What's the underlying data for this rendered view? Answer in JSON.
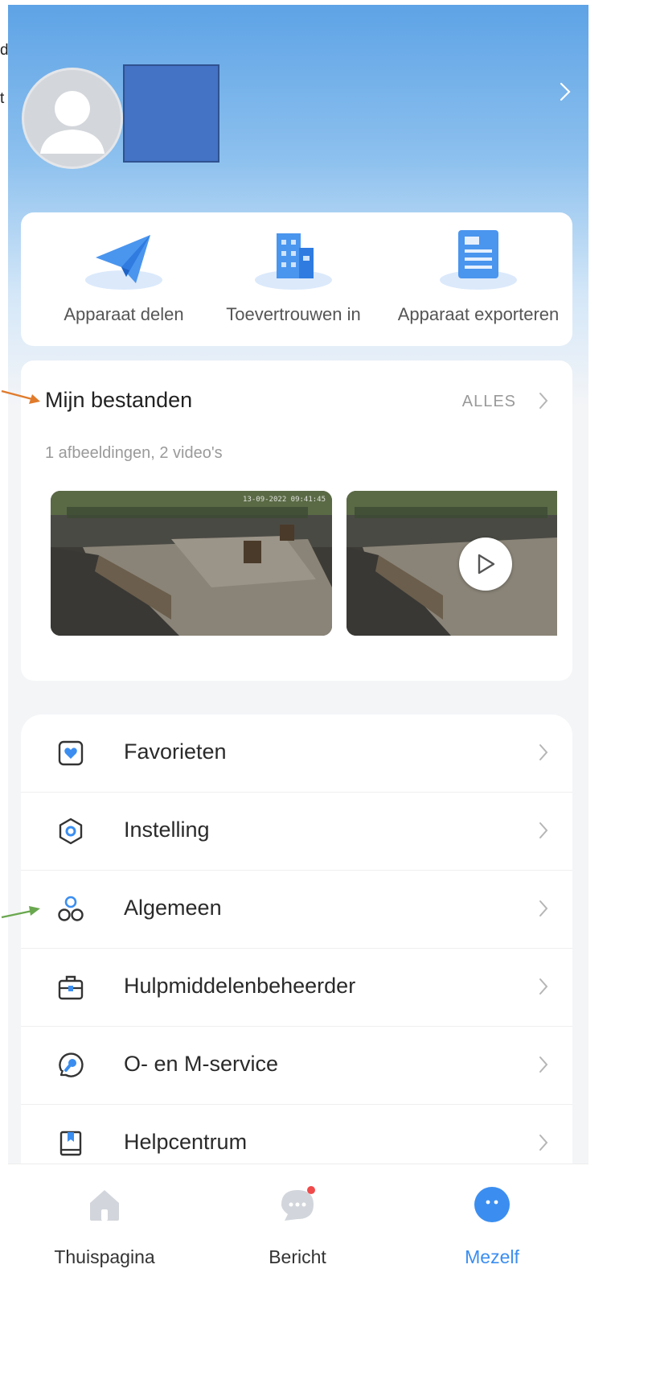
{
  "margin_notes": {
    "line1": "d",
    "line2": "t"
  },
  "header": {
    "username": ""
  },
  "quick_actions": [
    {
      "label": "Apparaat delen",
      "icon": "paper-plane-icon"
    },
    {
      "label": "Toevertrouwen in",
      "icon": "building-icon"
    },
    {
      "label": "Apparaat exporteren",
      "icon": "document-list-icon"
    }
  ],
  "files": {
    "title": "Mijn bestanden",
    "all_label": "ALLES",
    "summary": "1 afbeeldingen, 2 video's",
    "thumbnails": [
      {
        "type": "image",
        "timestamp": "13-09-2022 09:41:45"
      },
      {
        "type": "video"
      }
    ]
  },
  "menu": [
    {
      "label": "Favorieten",
      "icon": "heart-frame-icon"
    },
    {
      "label": "Instelling",
      "icon": "settings-hexagon-icon"
    },
    {
      "label": "Algemeen",
      "icon": "group-circles-icon"
    },
    {
      "label": "Hulpmiddelenbeheerder",
      "icon": "toolbox-icon"
    },
    {
      "label": "O- en M-service",
      "icon": "wrench-circle-icon"
    },
    {
      "label": "Helpcentrum",
      "icon": "book-icon"
    }
  ],
  "bottom_nav": [
    {
      "label": "Thuispagina",
      "icon": "home-icon",
      "active": false
    },
    {
      "label": "Bericht",
      "icon": "chat-bubble-icon",
      "active": false,
      "badge": true
    },
    {
      "label": "Mezelf",
      "icon": "face-icon",
      "active": true
    }
  ],
  "colors": {
    "accent": "#3b8ef0",
    "icon_blue": "#2f7be0",
    "arrow_orange": "#e07b2c",
    "arrow_green": "#6aa84f",
    "redaction": "#4472c4"
  }
}
